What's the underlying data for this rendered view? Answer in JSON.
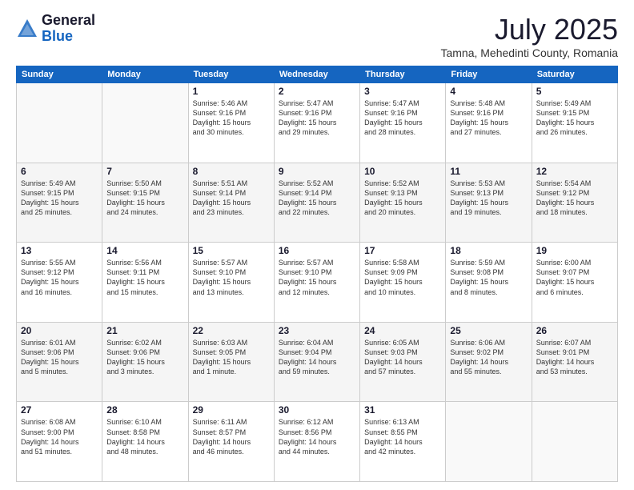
{
  "header": {
    "logo_general": "General",
    "logo_blue": "Blue",
    "month": "July 2025",
    "location": "Tamna, Mehedinti County, Romania"
  },
  "weekdays": [
    "Sunday",
    "Monday",
    "Tuesday",
    "Wednesday",
    "Thursday",
    "Friday",
    "Saturday"
  ],
  "weeks": [
    [
      {
        "day": "",
        "info": ""
      },
      {
        "day": "",
        "info": ""
      },
      {
        "day": "1",
        "info": "Sunrise: 5:46 AM\nSunset: 9:16 PM\nDaylight: 15 hours\nand 30 minutes."
      },
      {
        "day": "2",
        "info": "Sunrise: 5:47 AM\nSunset: 9:16 PM\nDaylight: 15 hours\nand 29 minutes."
      },
      {
        "day": "3",
        "info": "Sunrise: 5:47 AM\nSunset: 9:16 PM\nDaylight: 15 hours\nand 28 minutes."
      },
      {
        "day": "4",
        "info": "Sunrise: 5:48 AM\nSunset: 9:16 PM\nDaylight: 15 hours\nand 27 minutes."
      },
      {
        "day": "5",
        "info": "Sunrise: 5:49 AM\nSunset: 9:15 PM\nDaylight: 15 hours\nand 26 minutes."
      }
    ],
    [
      {
        "day": "6",
        "info": "Sunrise: 5:49 AM\nSunset: 9:15 PM\nDaylight: 15 hours\nand 25 minutes."
      },
      {
        "day": "7",
        "info": "Sunrise: 5:50 AM\nSunset: 9:15 PM\nDaylight: 15 hours\nand 24 minutes."
      },
      {
        "day": "8",
        "info": "Sunrise: 5:51 AM\nSunset: 9:14 PM\nDaylight: 15 hours\nand 23 minutes."
      },
      {
        "day": "9",
        "info": "Sunrise: 5:52 AM\nSunset: 9:14 PM\nDaylight: 15 hours\nand 22 minutes."
      },
      {
        "day": "10",
        "info": "Sunrise: 5:52 AM\nSunset: 9:13 PM\nDaylight: 15 hours\nand 20 minutes."
      },
      {
        "day": "11",
        "info": "Sunrise: 5:53 AM\nSunset: 9:13 PM\nDaylight: 15 hours\nand 19 minutes."
      },
      {
        "day": "12",
        "info": "Sunrise: 5:54 AM\nSunset: 9:12 PM\nDaylight: 15 hours\nand 18 minutes."
      }
    ],
    [
      {
        "day": "13",
        "info": "Sunrise: 5:55 AM\nSunset: 9:12 PM\nDaylight: 15 hours\nand 16 minutes."
      },
      {
        "day": "14",
        "info": "Sunrise: 5:56 AM\nSunset: 9:11 PM\nDaylight: 15 hours\nand 15 minutes."
      },
      {
        "day": "15",
        "info": "Sunrise: 5:57 AM\nSunset: 9:10 PM\nDaylight: 15 hours\nand 13 minutes."
      },
      {
        "day": "16",
        "info": "Sunrise: 5:57 AM\nSunset: 9:10 PM\nDaylight: 15 hours\nand 12 minutes."
      },
      {
        "day": "17",
        "info": "Sunrise: 5:58 AM\nSunset: 9:09 PM\nDaylight: 15 hours\nand 10 minutes."
      },
      {
        "day": "18",
        "info": "Sunrise: 5:59 AM\nSunset: 9:08 PM\nDaylight: 15 hours\nand 8 minutes."
      },
      {
        "day": "19",
        "info": "Sunrise: 6:00 AM\nSunset: 9:07 PM\nDaylight: 15 hours\nand 6 minutes."
      }
    ],
    [
      {
        "day": "20",
        "info": "Sunrise: 6:01 AM\nSunset: 9:06 PM\nDaylight: 15 hours\nand 5 minutes."
      },
      {
        "day": "21",
        "info": "Sunrise: 6:02 AM\nSunset: 9:06 PM\nDaylight: 15 hours\nand 3 minutes."
      },
      {
        "day": "22",
        "info": "Sunrise: 6:03 AM\nSunset: 9:05 PM\nDaylight: 15 hours\nand 1 minute."
      },
      {
        "day": "23",
        "info": "Sunrise: 6:04 AM\nSunset: 9:04 PM\nDaylight: 14 hours\nand 59 minutes."
      },
      {
        "day": "24",
        "info": "Sunrise: 6:05 AM\nSunset: 9:03 PM\nDaylight: 14 hours\nand 57 minutes."
      },
      {
        "day": "25",
        "info": "Sunrise: 6:06 AM\nSunset: 9:02 PM\nDaylight: 14 hours\nand 55 minutes."
      },
      {
        "day": "26",
        "info": "Sunrise: 6:07 AM\nSunset: 9:01 PM\nDaylight: 14 hours\nand 53 minutes."
      }
    ],
    [
      {
        "day": "27",
        "info": "Sunrise: 6:08 AM\nSunset: 9:00 PM\nDaylight: 14 hours\nand 51 minutes."
      },
      {
        "day": "28",
        "info": "Sunrise: 6:10 AM\nSunset: 8:58 PM\nDaylight: 14 hours\nand 48 minutes."
      },
      {
        "day": "29",
        "info": "Sunrise: 6:11 AM\nSunset: 8:57 PM\nDaylight: 14 hours\nand 46 minutes."
      },
      {
        "day": "30",
        "info": "Sunrise: 6:12 AM\nSunset: 8:56 PM\nDaylight: 14 hours\nand 44 minutes."
      },
      {
        "day": "31",
        "info": "Sunrise: 6:13 AM\nSunset: 8:55 PM\nDaylight: 14 hours\nand 42 minutes."
      },
      {
        "day": "",
        "info": ""
      },
      {
        "day": "",
        "info": ""
      }
    ]
  ]
}
